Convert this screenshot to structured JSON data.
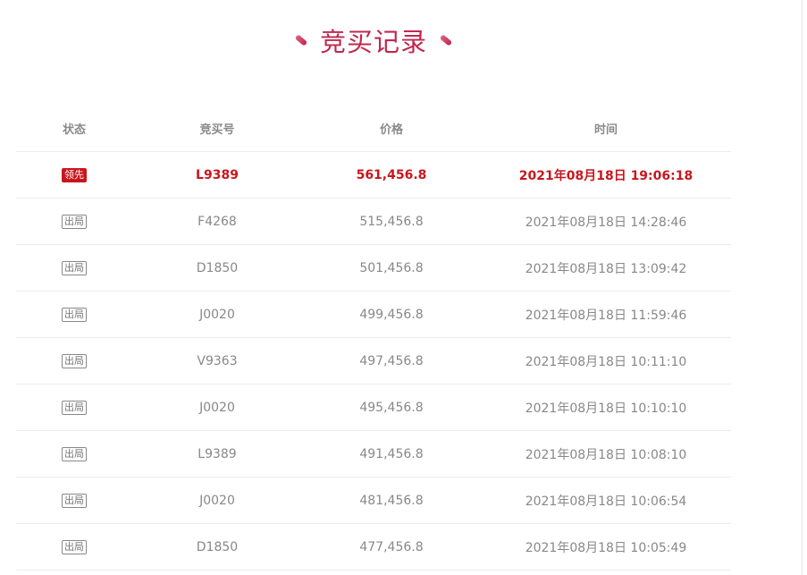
{
  "title": "竞买记录",
  "table": {
    "headers": {
      "status": "状态",
      "bid_no": "竞买号",
      "price": "价格",
      "time": "时间"
    },
    "rows": [
      {
        "status": "领先",
        "bid_no": "L9389",
        "price": "561,456.8",
        "time": "2021年08月18日 19:06:18",
        "leading": true
      },
      {
        "status": "出局",
        "bid_no": "F4268",
        "price": "515,456.8",
        "time": "2021年08月18日 14:28:46",
        "leading": false
      },
      {
        "status": "出局",
        "bid_no": "D1850",
        "price": "501,456.8",
        "time": "2021年08月18日 13:09:42",
        "leading": false
      },
      {
        "status": "出局",
        "bid_no": "J0020",
        "price": "499,456.8",
        "time": "2021年08月18日 11:59:46",
        "leading": false
      },
      {
        "status": "出局",
        "bid_no": "V9363",
        "price": "497,456.8",
        "time": "2021年08月18日 10:11:10",
        "leading": false
      },
      {
        "status": "出局",
        "bid_no": "J0020",
        "price": "495,456.8",
        "time": "2021年08月18日 10:10:10",
        "leading": false
      },
      {
        "status": "出局",
        "bid_no": "L9389",
        "price": "491,456.8",
        "time": "2021年08月18日 10:08:10",
        "leading": false
      },
      {
        "status": "出局",
        "bid_no": "J0020",
        "price": "481,456.8",
        "time": "2021年08月18日 10:06:54",
        "leading": false
      },
      {
        "status": "出局",
        "bid_no": "D1850",
        "price": "477,456.8",
        "time": "2021年08月18日 10:05:49",
        "leading": false
      }
    ]
  },
  "colors": {
    "accent": "#c0284e",
    "lead": "#c8161d",
    "text": "#888888",
    "divider": "#ececec"
  }
}
